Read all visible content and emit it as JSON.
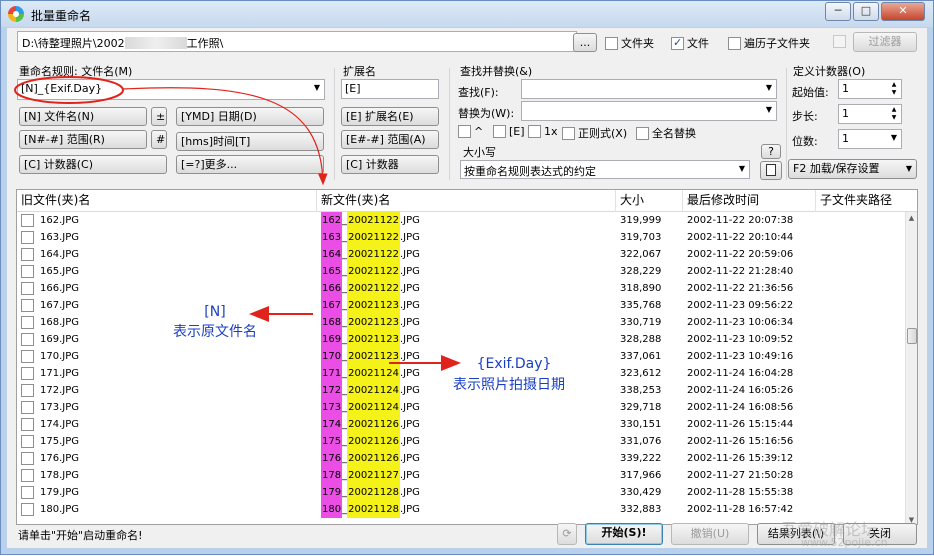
{
  "window": {
    "title": "批量重命名",
    "minimize": "─",
    "maximize": "□",
    "close": "✕"
  },
  "path": {
    "prefix": "D:\\待整理照片\\2002",
    "suffix": "工作照\\",
    "browse": "...",
    "folder_label": "文件夹",
    "folder_checked": false,
    "file_label": "文件",
    "file_checked": true,
    "subfolder_label": "遍历子文件夹",
    "subfolder_checked": false,
    "filter_label": "过滤器"
  },
  "rule": {
    "label": "重命名规则: 文件名(M)",
    "value": "[N]_{Exif.Day}",
    "btn_name": "[N] 文件名(N)",
    "btn_pm": "±",
    "btn_date": "[YMD] 日期(D)",
    "btn_range": "[N#-#] 范围(R)",
    "btn_hash": "#",
    "btn_time": "[hms]时间[T]",
    "btn_counter": "[C] 计数器(C)",
    "btn_more": "[=?]更多..."
  },
  "ext": {
    "label": "扩展名",
    "value": "[E]",
    "btn_ext": "[E] 扩展名(E)",
    "btn_range": "[E#-#] 范围(A)",
    "btn_counter": "[C] 计数器"
  },
  "replace": {
    "label": "查找并替换(&)",
    "find_label": "查找(F):",
    "find_value": "",
    "replace_label": "替换为(W):",
    "replace_value": "",
    "opt_caret": "^",
    "opt_e": "[E]",
    "opt_1x": "1x",
    "opt_regex": "正则式(X)",
    "opt_fullname": "全名替换",
    "case_label": "大小写",
    "case_value": "按重命名规则表达式的约定",
    "help": "?"
  },
  "counter": {
    "label": "定义计数器(O)",
    "start_label": "起始值:",
    "start_value": "1",
    "step_label": "步长:",
    "step_value": "1",
    "digits_label": "位数:",
    "digits_value": "1",
    "load_save": "F2 加载/保存设置"
  },
  "columns": {
    "old": "旧文件(夹)名",
    "new": "新文件(夹)名",
    "size": "大小",
    "mtime": "最后修改时间",
    "subpath": "子文件夹路径"
  },
  "rows": [
    {
      "old": "162.JPG",
      "n": "162",
      "sep": "_",
      "day": "20021122",
      "ext": ".JPG",
      "size": "319,999",
      "time": "2002-11-22 20:07:38"
    },
    {
      "old": "163.JPG",
      "n": "163",
      "sep": "_",
      "day": "20021122",
      "ext": ".JPG",
      "size": "319,703",
      "time": "2002-11-22 20:10:44"
    },
    {
      "old": "164.JPG",
      "n": "164",
      "sep": "_",
      "day": "20021122",
      "ext": ".JPG",
      "size": "322,067",
      "time": "2002-11-22 20:59:06"
    },
    {
      "old": "165.JPG",
      "n": "165",
      "sep": "_",
      "day": "20021122",
      "ext": ".JPG",
      "size": "328,229",
      "time": "2002-11-22 21:28:40"
    },
    {
      "old": "166.JPG",
      "n": "166",
      "sep": "_",
      "day": "20021122",
      "ext": ".JPG",
      "size": "318,890",
      "time": "2002-11-22 21:36:56"
    },
    {
      "old": "167.JPG",
      "n": "167",
      "sep": "_",
      "day": "20021123",
      "ext": ".JPG",
      "size": "335,768",
      "time": "2002-11-23 09:56:22"
    },
    {
      "old": "168.JPG",
      "n": "168",
      "sep": "_",
      "day": "20021123",
      "ext": ".JPG",
      "size": "330,719",
      "time": "2002-11-23 10:06:34"
    },
    {
      "old": "169.JPG",
      "n": "169",
      "sep": "_",
      "day": "20021123",
      "ext": ".JPG",
      "size": "328,288",
      "time": "2002-11-23 10:09:52"
    },
    {
      "old": "170.JPG",
      "n": "170",
      "sep": "_",
      "day": "20021123",
      "ext": ".JPG",
      "size": "337,061",
      "time": "2002-11-23 10:49:16"
    },
    {
      "old": "171.JPG",
      "n": "171",
      "sep": "_",
      "day": "20021124",
      "ext": ".JPG",
      "size": "323,612",
      "time": "2002-11-24 16:04:28"
    },
    {
      "old": "172.JPG",
      "n": "172",
      "sep": "_",
      "day": "20021124",
      "ext": ".JPG",
      "size": "338,253",
      "time": "2002-11-24 16:05:26"
    },
    {
      "old": "173.JPG",
      "n": "173",
      "sep": "_",
      "day": "20021124",
      "ext": ".JPG",
      "size": "329,718",
      "time": "2002-11-24 16:08:56"
    },
    {
      "old": "174.JPG",
      "n": "174",
      "sep": "_",
      "day": "20021126",
      "ext": ".JPG",
      "size": "330,151",
      "time": "2002-11-26 15:15:44"
    },
    {
      "old": "175.JPG",
      "n": "175",
      "sep": "_",
      "day": "20021126",
      "ext": ".JPG",
      "size": "331,076",
      "time": "2002-11-26 15:16:56"
    },
    {
      "old": "176.JPG",
      "n": "176",
      "sep": "_",
      "day": "20021126",
      "ext": ".JPG",
      "size": "339,222",
      "time": "2002-11-26 15:39:12"
    },
    {
      "old": "178.JPG",
      "n": "178",
      "sep": "_",
      "day": "20021127",
      "ext": ".JPG",
      "size": "317,966",
      "time": "2002-11-27 21:50:28"
    },
    {
      "old": "179.JPG",
      "n": "179",
      "sep": "_",
      "day": "20021128",
      "ext": ".JPG",
      "size": "330,429",
      "time": "2002-11-28 15:55:38"
    },
    {
      "old": "180.JPG",
      "n": "180",
      "sep": "_",
      "day": "20021128",
      "ext": ".JPG",
      "size": "332,883",
      "time": "2002-11-28 16:57:42"
    }
  ],
  "annotations": {
    "n_title": "[N]",
    "n_desc": "表示原文件名",
    "day_title": "{Exif.Day}",
    "day_desc": "表示照片拍摄日期"
  },
  "bottom": {
    "status": "请单击\"开始\"启动重命名!",
    "start": "开始(S)!",
    "undo": "撤销(U)",
    "results": "结果列表(\\)",
    "close": "关闭"
  },
  "watermark": {
    "line1": "吾爱破解论坛",
    "line2": "www.52pojie.cn"
  },
  "colors": {
    "highlight_n": "#ea4ee5",
    "highlight_day": "#f5f21a",
    "annotation": "#1a3fc3",
    "arrow": "#e0231b"
  }
}
